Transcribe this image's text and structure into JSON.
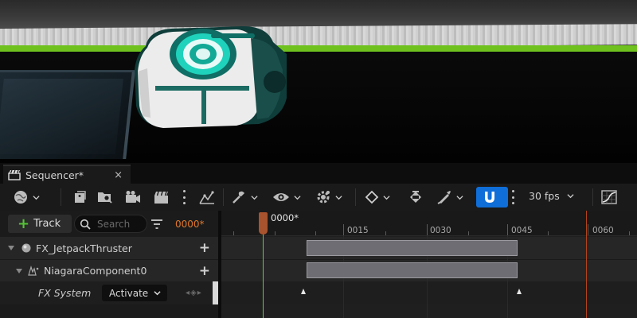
{
  "tab": {
    "title": "Sequencer*",
    "close": "×"
  },
  "toolbar": {
    "fps": "30 fps",
    "accent": "#0f6ed8"
  },
  "left": {
    "add_track": "Track",
    "search_placeholder": "Search",
    "timecode": "0000*",
    "tracks": [
      {
        "name": "FX_JetpackThruster"
      },
      {
        "name": "NiagaraComponent0"
      }
    ],
    "fx_system": {
      "label": "FX System",
      "value": "Activate"
    }
  },
  "timeline": {
    "current": "0000*",
    "labels": [
      "0015",
      "0030",
      "0045",
      "0060"
    ],
    "playhead_color": "#a8532e",
    "end_color": "#b3431a"
  },
  "icons": [
    "camera-icon",
    "viewport-sphere-icon",
    "render-movie-icon",
    "find-in-content-icon",
    "actor-to-sequencer-icon",
    "clapperboard-icon",
    "kebab-icon",
    "graph-icon",
    "tools-icon",
    "eye-icon",
    "gear-icon",
    "keyframe-diamond-icon",
    "key-paint-icon",
    "brush-icon",
    "magnet-icon",
    "curve-editor-icon",
    "filter-icon",
    "niagara-icon"
  ]
}
